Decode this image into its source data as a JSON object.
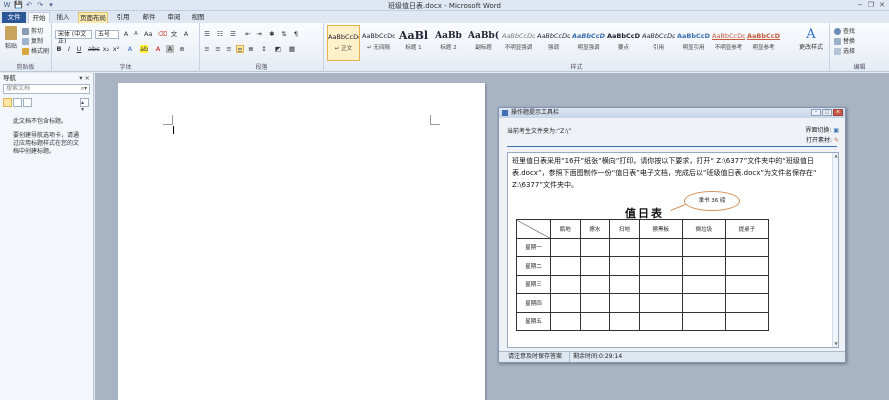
{
  "window": {
    "title": "班级值日表.docx - Microsoft Word",
    "controls": [
      "−",
      "❐",
      "✕"
    ]
  },
  "qat": [
    "W",
    "💾",
    "↶",
    "↷",
    "▾"
  ],
  "tabs": [
    "文件",
    "开始",
    "插入",
    "页面布局",
    "引用",
    "邮件",
    "审阅",
    "视图"
  ],
  "ribbon": {
    "clipboard": {
      "label": "剪贴板",
      "paste": "粘贴",
      "cut": "剪切",
      "copy": "复制",
      "format_painter": "格式刷"
    },
    "font": {
      "label": "字体",
      "font_name": "宋体 (中文正)",
      "font_size": "五号"
    },
    "paragraph": {
      "label": "段落"
    },
    "styles": {
      "label": "样式",
      "items": [
        {
          "sample": "AaBbCcDd",
          "name": "↵ 正文"
        },
        {
          "sample": "AaBbCcDd",
          "name": "↵ 无间隔"
        },
        {
          "sample": "AaBl",
          "name": "标题 1"
        },
        {
          "sample": "AaBb",
          "name": "标题 2"
        },
        {
          "sample": "AaBb(",
          "name": "副标题"
        },
        {
          "sample": "AaBbCcDd",
          "name": "不明显强调"
        },
        {
          "sample": "AaBbCcDd",
          "name": "强调"
        },
        {
          "sample": "AaBbCcDd",
          "name": "明显强调"
        },
        {
          "sample": "AaBbCcDd",
          "name": "要点"
        },
        {
          "sample": "AaBbCcDd",
          "name": "引用"
        },
        {
          "sample": "AaBbCcDd",
          "name": "明显引用"
        },
        {
          "sample": "AaBbCcDd",
          "name": "不明显参考"
        },
        {
          "sample": "AaBbCcDd",
          "name": "明显参考"
        }
      ],
      "change_styles": "更改样式"
    },
    "editing": {
      "label": "编辑",
      "find": "查找",
      "replace": "替换",
      "select": "选择"
    }
  },
  "nav": {
    "title": "导航",
    "search_placeholder": "搜索文档",
    "message1": "此文档不包含标题。",
    "message2": "要创建导航选项卡，请通过应用标题样式在您的文档中创建标题。"
  },
  "tool": {
    "title": "操作题提示工具栏",
    "folder_label": "当前考生文件夹为:“Z:\\”",
    "switch_label": "界面切换:",
    "open_label": "打开素材:",
    "question": "班里值日表采用“16开”纸张“横向”打印。请你按以下要求，打开“ Z:\\6377”文件夹中的“班级值日表.docx”，参照下面图制作一份“值日表”电子文档，完成后以“班级值日表.docx”为文件名保存在“ Z:\\6377”文件夹中。",
    "figure": {
      "title": "值日表",
      "callout": "隶书 36 磅",
      "columns": [
        "",
        "瓶地",
        "擦水",
        "扫地",
        "擦黑板",
        "倒垃圾",
        "提桌子"
      ],
      "rows": [
        "星期一",
        "星期二",
        "星期三",
        "星期四",
        "星期五"
      ]
    },
    "status_save": "请注意及时保存答案",
    "status_time": "剩余时间:0:29:14"
  },
  "colors": {
    "file_tab": "#2b5797",
    "accent": "#3a6fb0"
  }
}
